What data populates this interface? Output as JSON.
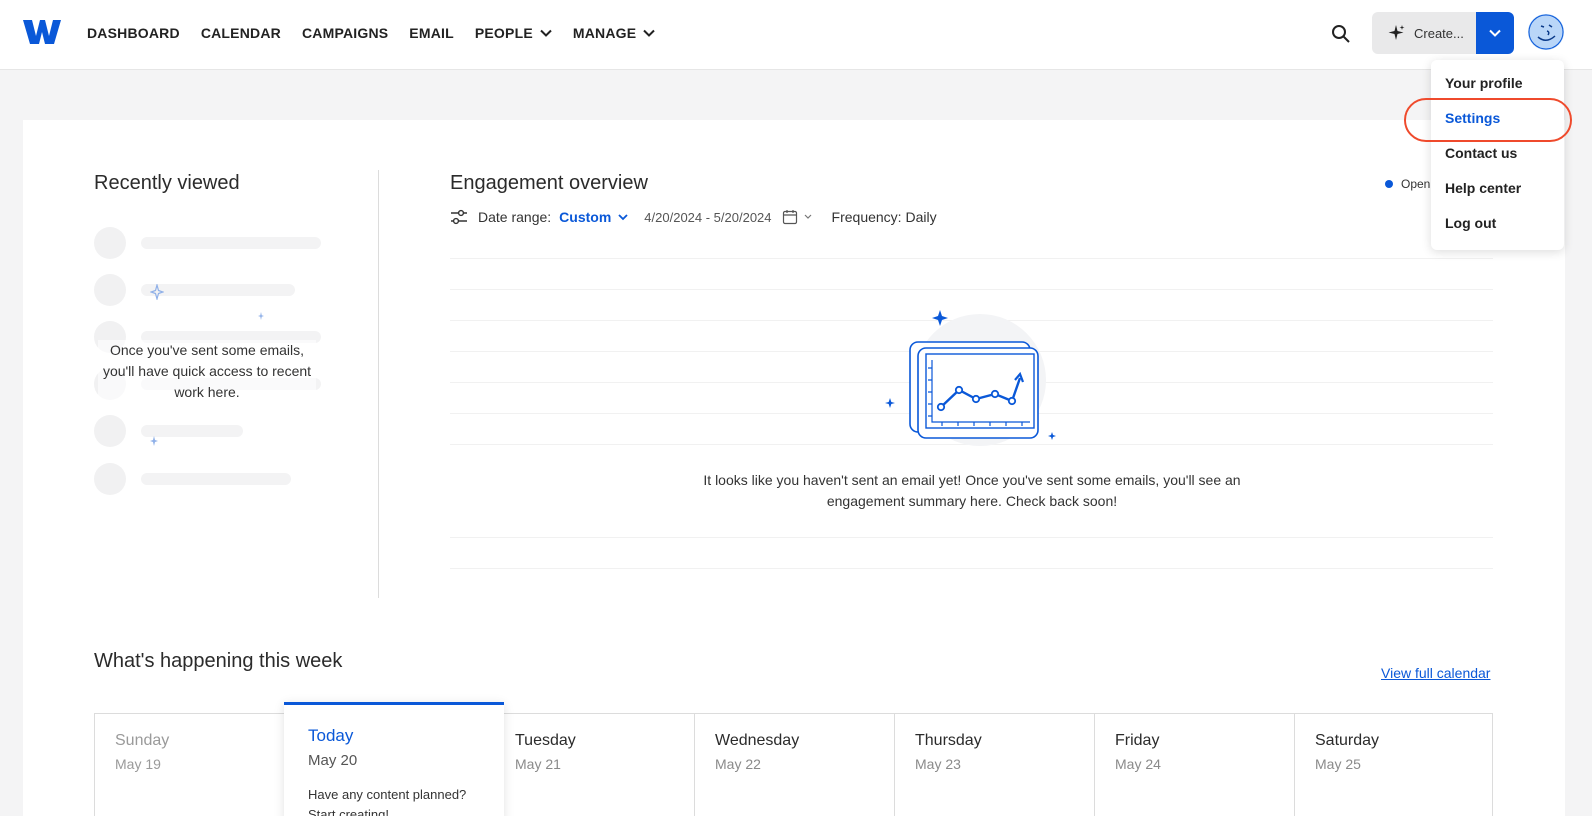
{
  "nav": {
    "items": [
      {
        "label": "DASHBOARD",
        "dropdown": false
      },
      {
        "label": "CALENDAR",
        "dropdown": false
      },
      {
        "label": "CAMPAIGNS",
        "dropdown": false
      },
      {
        "label": "EMAIL",
        "dropdown": false
      },
      {
        "label": "PEOPLE",
        "dropdown": true
      },
      {
        "label": "MANAGE",
        "dropdown": true
      }
    ],
    "create_label": "Create...",
    "brand_color": "#0a58d8"
  },
  "profile_menu": {
    "items": [
      "Your profile",
      "Settings",
      "Contact us",
      "Help center",
      "Log out"
    ],
    "highlighted": "Settings"
  },
  "recent": {
    "title": "Recently viewed",
    "message": "Once you've sent some emails, you'll have quick access to recent work here."
  },
  "engagement": {
    "title": "Engagement overview",
    "date_range_label": "Date range:",
    "date_range_value": "Custom",
    "dates": "4/20/2024 - 5/20/2024",
    "frequency": "Frequency: Daily",
    "legend_open": "Open",
    "empty_message": "It looks like you haven't sent an email yet! Once you've sent some emails, you'll see an engagement summary here. Check back soon!"
  },
  "week": {
    "title": "What's happening this week",
    "full_calendar_link": "View full calendar",
    "today": {
      "name": "Today",
      "date": "May 20",
      "prompt": "Have any content planned? Start creating!"
    },
    "days": [
      {
        "name": "Sunday",
        "date": "May 19"
      },
      {
        "name": "Tuesday",
        "date": "May 21"
      },
      {
        "name": "Wednesday",
        "date": "May 22"
      },
      {
        "name": "Thursday",
        "date": "May 23"
      },
      {
        "name": "Friday",
        "date": "May 24"
      },
      {
        "name": "Saturday",
        "date": "May 25"
      }
    ]
  }
}
